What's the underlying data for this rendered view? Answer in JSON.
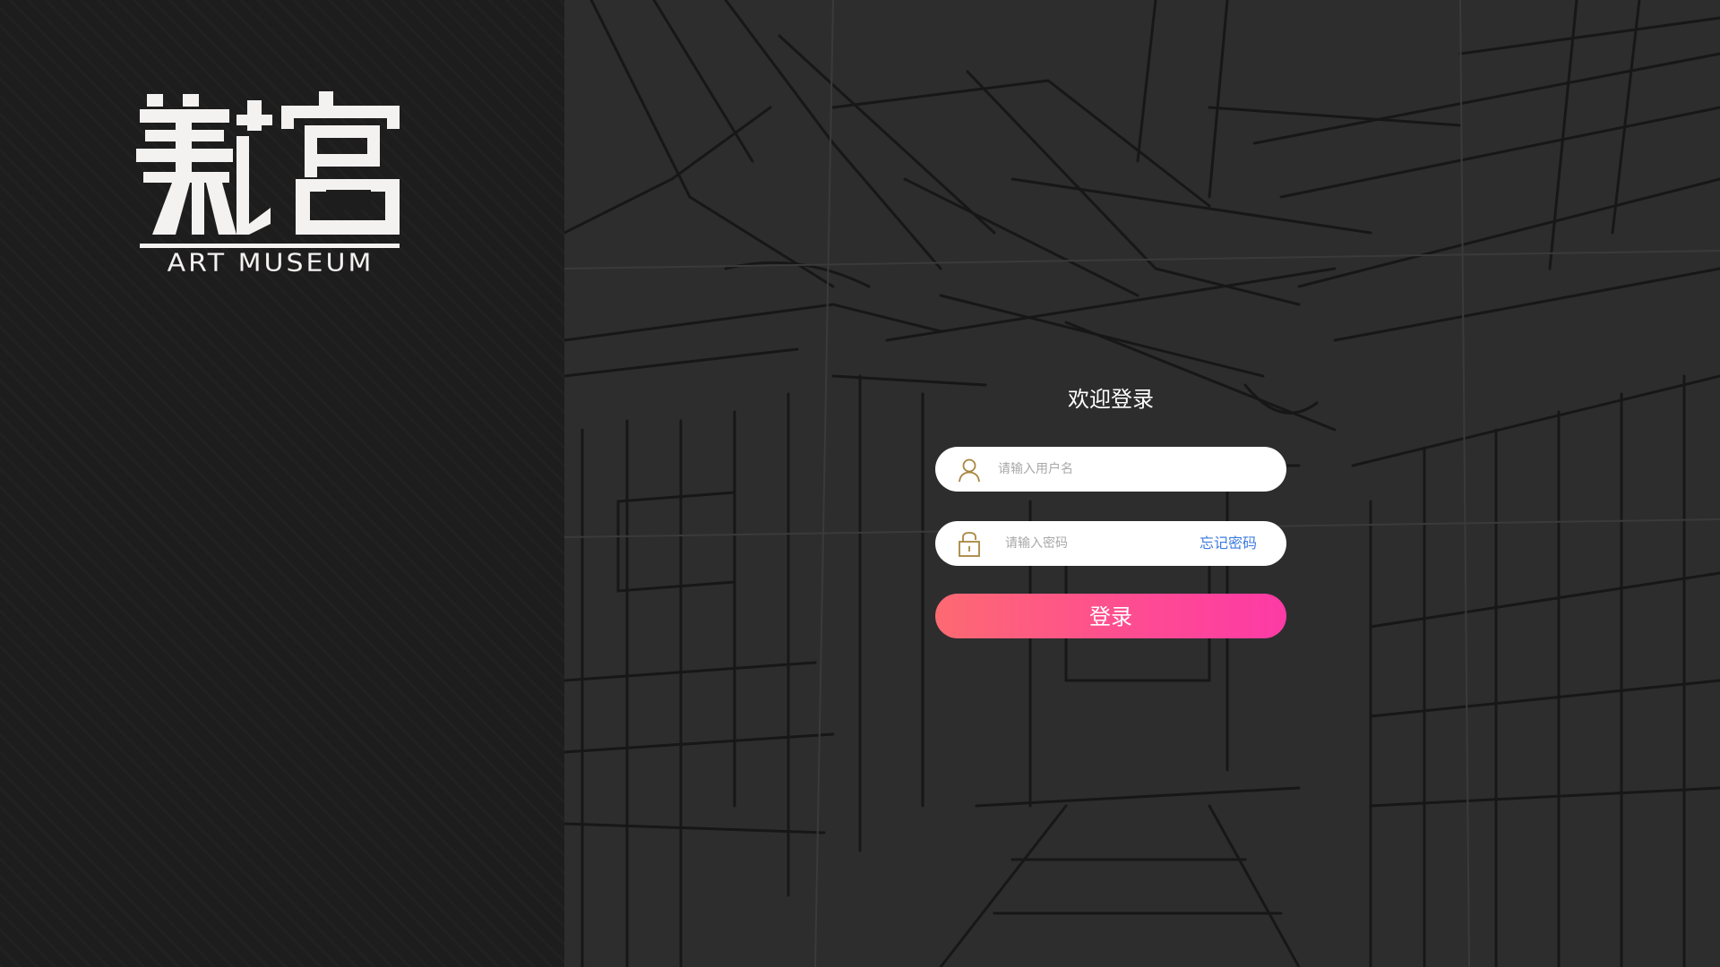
{
  "brand": {
    "logo_cn": "美馆",
    "logo_en": "ART MUSEUM"
  },
  "login": {
    "title": "欢迎登录",
    "username": {
      "placeholder": "请输入用户名",
      "icon": "user-icon"
    },
    "password": {
      "placeholder": "请输入密码",
      "icon": "lock-icon",
      "forgot_label": "忘记密码"
    },
    "submit_label": "登录"
  },
  "colors": {
    "left_panel": "#1e1d1e",
    "background": "#2d2d2e",
    "icon_gold": "#a8863e",
    "link_blue": "#3d7be0",
    "button_gradient_start": "#fd6a72",
    "button_gradient_end": "#fd3aa6"
  }
}
